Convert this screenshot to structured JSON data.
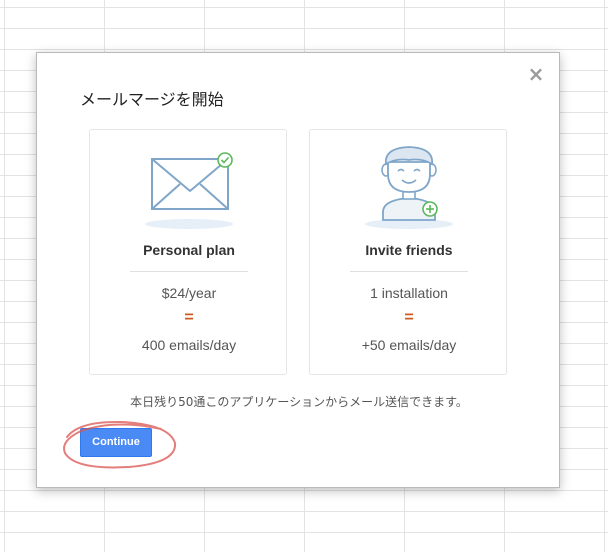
{
  "dialog": {
    "title": "メールマージを開始",
    "close_label": "×",
    "notice": "本日残り50通このアプリケーションからメール送信できます。",
    "continue_label": "Continue"
  },
  "plans": [
    {
      "title": "Personal plan",
      "price": "$24/year",
      "equals": "=",
      "quota": "400 emails/day",
      "icon": "envelope-check-icon"
    },
    {
      "title": "Invite friends",
      "price": "1 installation",
      "equals": "=",
      "quota": "+50 emails/day",
      "icon": "person-plus-icon"
    }
  ],
  "colors": {
    "accent_blue": "#4a8af4",
    "equals_orange": "#d0591e",
    "illustration_blue": "#7fa6c9",
    "check_green": "#5cb85c",
    "annotation_red": "#d9534f"
  }
}
